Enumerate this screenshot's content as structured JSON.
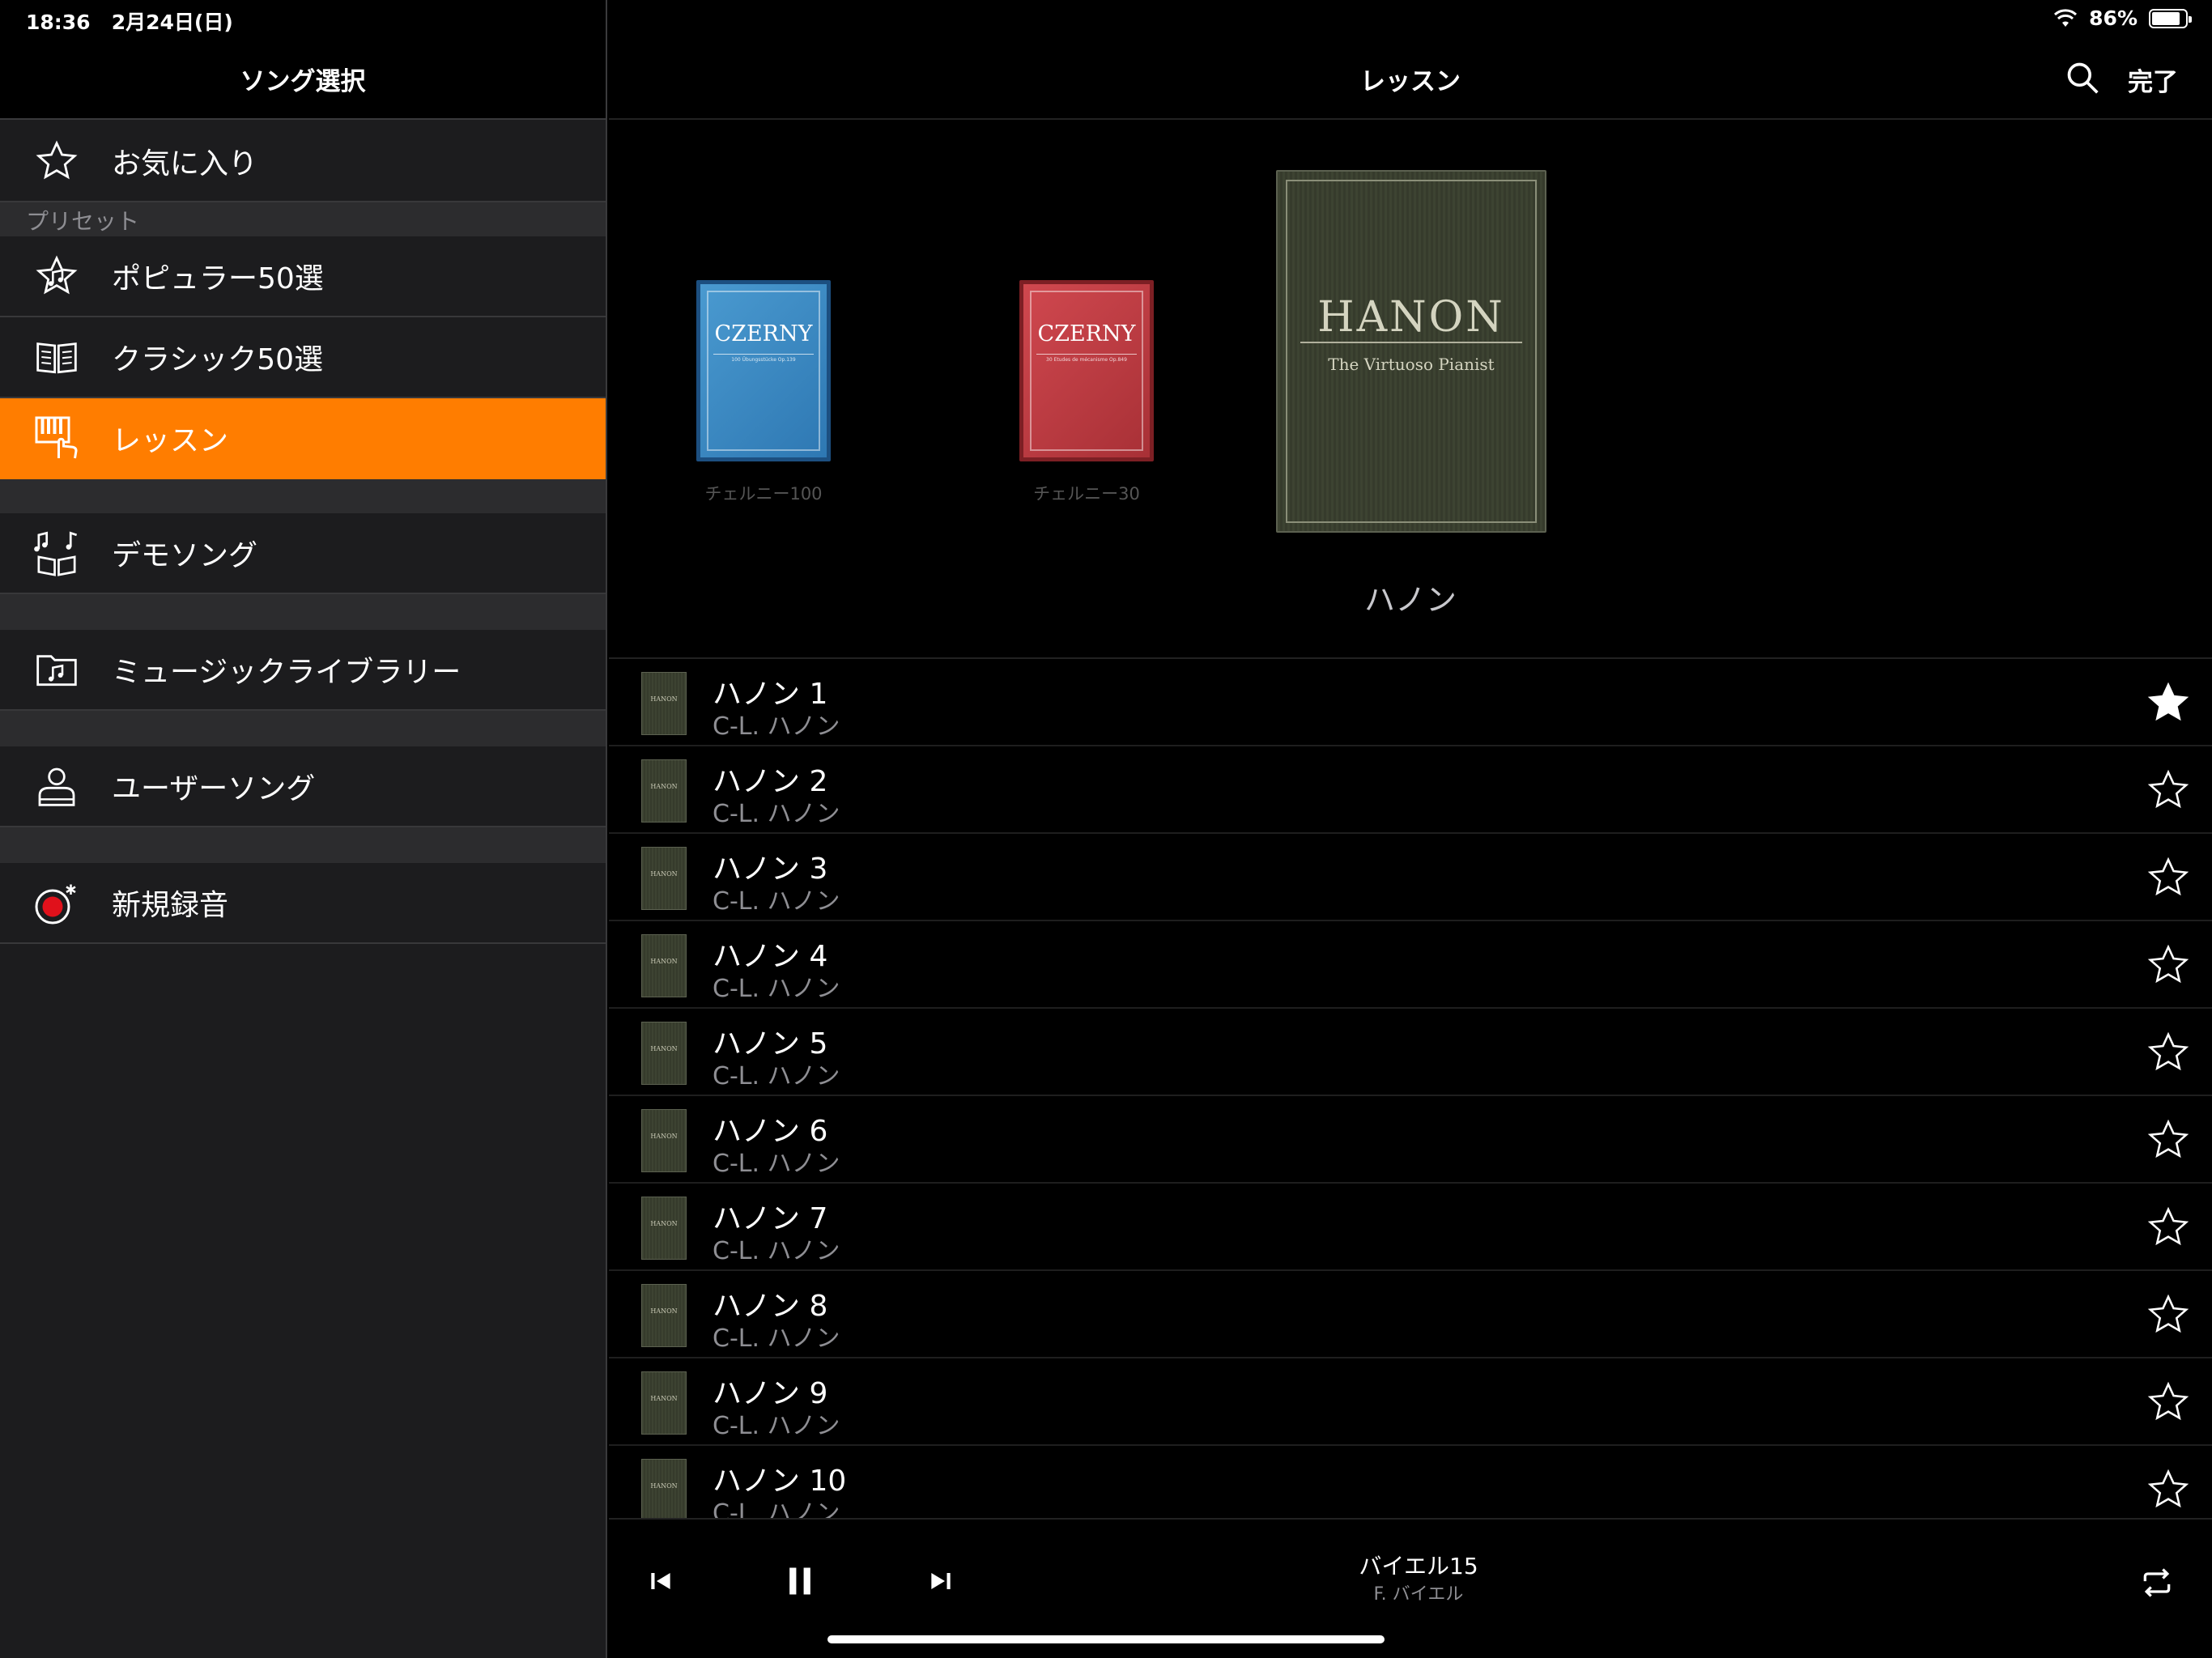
{
  "status_bar": {
    "time": "18:36",
    "date": "2月24日(日)",
    "battery": "86%",
    "battery_level": 0.86
  },
  "sidebar": {
    "title": "ソング選択",
    "favorites": "お気に入り",
    "section_label": "プリセット",
    "items": [
      {
        "label": "ポピュラー50選",
        "icon": "star-music-icon"
      },
      {
        "label": "クラシック50選",
        "icon": "open-book-icon"
      },
      {
        "label": "レッスン",
        "icon": "piano-hand-icon",
        "active": true
      },
      {
        "label": "デモソング",
        "icon": "music-notes-book-icon"
      },
      {
        "label": "ミュージックライブラリー",
        "icon": "folder-music-icon"
      },
      {
        "label": "ユーザーソング",
        "icon": "user-icon"
      },
      {
        "label": "新規録音",
        "icon": "record-icon"
      }
    ]
  },
  "main": {
    "title": "レッスン",
    "done": "完了",
    "books": [
      {
        "title": "CZERNY",
        "subtitle": "100 Übungsstücke Op.139",
        "label": "チェルニー100",
        "color": "#3b8ac4"
      },
      {
        "title": "CZERNY",
        "subtitle": "30 Etudes de mécanisme Op.849",
        "label": "チェルニー30",
        "color": "#c03c43"
      },
      {
        "title": "HANON",
        "subtitle": "The Virtuoso Pianist"
      }
    ],
    "current_book": "ハノン"
  },
  "songs": [
    {
      "title": "ハノン 1",
      "artist": "C-L. ハノン",
      "favorite": true
    },
    {
      "title": "ハノン 2",
      "artist": "C-L. ハノン",
      "favorite": false
    },
    {
      "title": "ハノン 3",
      "artist": "C-L. ハノン",
      "favorite": false
    },
    {
      "title": "ハノン 4",
      "artist": "C-L. ハノン",
      "favorite": false
    },
    {
      "title": "ハノン 5",
      "artist": "C-L. ハノン",
      "favorite": false
    },
    {
      "title": "ハノン 6",
      "artist": "C-L. ハノン",
      "favorite": false
    },
    {
      "title": "ハノン 7",
      "artist": "C-L. ハノン",
      "favorite": false
    },
    {
      "title": "ハノン 8",
      "artist": "C-L. ハノン",
      "favorite": false
    },
    {
      "title": "ハノン 9",
      "artist": "C-L. ハノン",
      "favorite": false
    },
    {
      "title": "ハノン 10",
      "artist": "C-L. ハノン",
      "favorite": false
    }
  ],
  "player": {
    "title": "バイエル15",
    "artist": "F. バイエル"
  },
  "colors": {
    "accent": "#ff7d00",
    "record": "#e0111b"
  }
}
